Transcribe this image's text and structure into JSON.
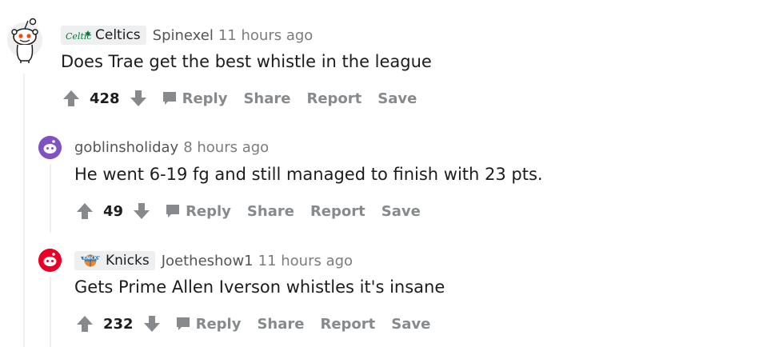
{
  "comments": [
    {
      "flair": {
        "text": "Celtics",
        "logo": "celtics-logo"
      },
      "username": "Spinexel",
      "time": "11 hours ago",
      "body": "Does Trae get the best whistle in the league",
      "score": "428",
      "actions": {
        "reply": "Reply",
        "share": "Share",
        "report": "Report",
        "save": "Save"
      },
      "avatar": "snoo-avatar"
    },
    {
      "flair": null,
      "username": "goblinsholiday",
      "time": "8 hours ago",
      "body": "He went 6-19 fg and still managed to finish with 23 pts.",
      "score": "49",
      "actions": {
        "reply": "Reply",
        "share": "Share",
        "report": "Report",
        "save": "Save"
      },
      "avatar": "default-avatar-purple"
    },
    {
      "flair": {
        "text": "Knicks",
        "logo": "knicks-logo"
      },
      "username": "Joetheshow1",
      "time": "11 hours ago",
      "body": "Gets Prime Allen Iverson whistles it's insane",
      "score": "232",
      "actions": {
        "reply": "Reply",
        "share": "Share",
        "report": "Report",
        "save": "Save"
      },
      "avatar": "default-avatar-red"
    }
  ],
  "colors": {
    "accent_purple": "#7e53c1",
    "accent_red": "#ea0027",
    "text_muted": "#878a8c",
    "thread_line": "#edeff1"
  }
}
